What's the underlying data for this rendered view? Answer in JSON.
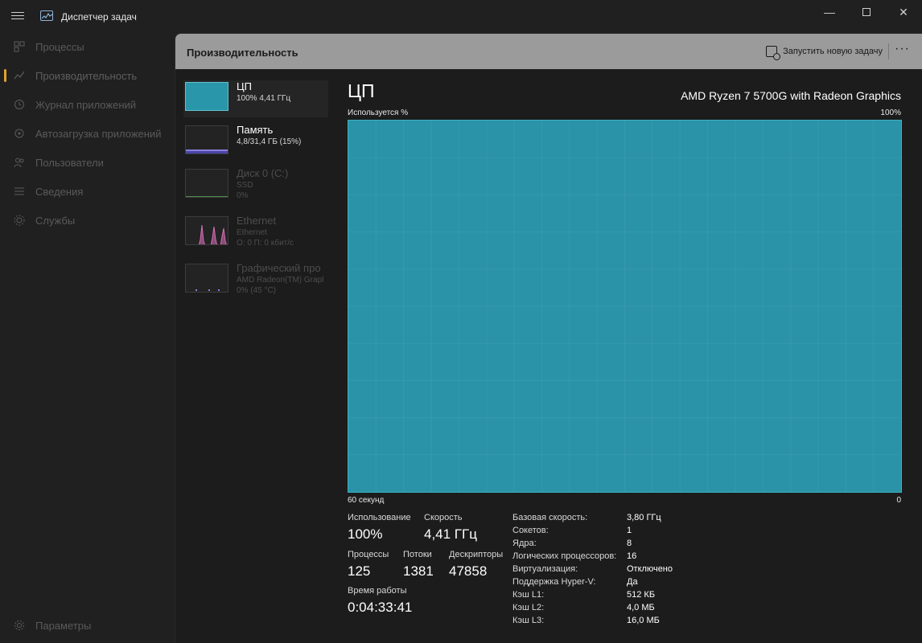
{
  "app": {
    "title": "Диспетчер задач"
  },
  "nav": {
    "items": [
      {
        "label": "Процессы",
        "icon": "grid-icon"
      },
      {
        "label": "Производительность",
        "icon": "performance-icon"
      },
      {
        "label": "Журнал приложений",
        "icon": "history-icon"
      },
      {
        "label": "Автозагрузка приложений",
        "icon": "startup-icon"
      },
      {
        "label": "Пользователи",
        "icon": "users-icon"
      },
      {
        "label": "Сведения",
        "icon": "details-icon"
      },
      {
        "label": "Службы",
        "icon": "services-icon"
      }
    ],
    "settings_label": "Параметры"
  },
  "header": {
    "title": "Производительность",
    "run_task_label": "Запустить новую задачу",
    "more_label": "···"
  },
  "devices": [
    {
      "name": "ЦП",
      "sub1": "100%  4,41 ГГц",
      "sub2": ""
    },
    {
      "name": "Память",
      "sub1": "4,8/31,4 ГБ (15%)",
      "sub2": ""
    },
    {
      "name": "Диск 0 (C:)",
      "sub1": "SSD",
      "sub2": "0%"
    },
    {
      "name": "Ethernet",
      "sub1": "Ethernet",
      "sub2": "О: 0 П: 0 кбит/с"
    },
    {
      "name": "Графический про",
      "sub1": "AMD Radeon(TM) Grapl",
      "sub2": "0% (45 °C)"
    }
  ],
  "cpu": {
    "title": "ЦП",
    "model": "AMD Ryzen 7 5700G with Radeon Graphics",
    "graph_label": "Используется %",
    "graph_max": "100%",
    "graph_time": "60 секунд",
    "graph_min": "0",
    "utilization_percent": 100,
    "stats": {
      "usage_label": "Использование",
      "usage_value": "100%",
      "speed_label": "Скорость",
      "speed_value": "4,41 ГГц",
      "processes_label": "Процессы",
      "processes_value": "125",
      "threads_label": "Потоки",
      "threads_value": "1381",
      "handles_label": "Дескрипторы",
      "handles_value": "47858",
      "uptime_label": "Время работы",
      "uptime_value": "0:04:33:41"
    },
    "specs": [
      {
        "label": "Базовая скорость:",
        "value": "3,80 ГГц"
      },
      {
        "label": "Сокетов:",
        "value": "1"
      },
      {
        "label": "Ядра:",
        "value": "8"
      },
      {
        "label": "Логических процессоров:",
        "value": "16"
      },
      {
        "label": "Виртуализация:",
        "value": "Отключено"
      },
      {
        "label": "Поддержка Hyper-V:",
        "value": "Да"
      },
      {
        "label": "Кэш L1:",
        "value": "512 КБ"
      },
      {
        "label": "Кэш L2:",
        "value": "4,0 МБ"
      },
      {
        "label": "Кэш L3:",
        "value": "16,0 МБ"
      }
    ]
  },
  "colors": {
    "accent": "#e0a22c",
    "cpu_graph": "#2a93a7",
    "memory": "#8a7fdc",
    "ethernet": "#d06fb0",
    "gpu": "#8a7fdc"
  }
}
